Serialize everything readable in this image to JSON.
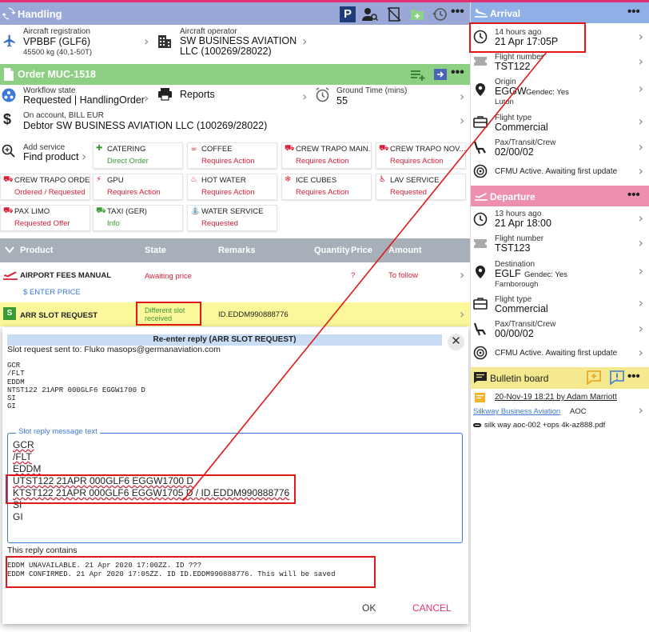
{
  "handling": {
    "title": "Handling",
    "aircraft_registration_label": "Aircraft registration",
    "aircraft_registration": "VPBBF (GLF6)",
    "aircraft_weight": "45500 kg (40,1-50T)",
    "aircraft_operator_label": "Aircraft operator",
    "aircraft_operator_line1": "SW BUSINESS AVIATION",
    "aircraft_operator_line2": "LLC (100269/28022)"
  },
  "order": {
    "title": "Order MUC-1518",
    "workflow_label": "Workflow state",
    "workflow_value": "Requested | HandlingOrder",
    "reports_label": "Reports",
    "ground_time_label": "Ground Time (mins)",
    "ground_time_value": "55",
    "account_label": "On account, BILL EUR",
    "account_value": "Debtor SW BUSINESS AVIATION LLC (100269/28022)",
    "add_service_label": "Add service",
    "find_product_label": "Find product"
  },
  "services": [
    {
      "name": "CATERING",
      "status": "Direct Order",
      "status_color": "#3a9a35",
      "icon": "catering-icon"
    },
    {
      "name": "COFFEE",
      "status": "Requires Action",
      "status_color": "#d6213a",
      "icon": "coffee-icon"
    },
    {
      "name": "CREW TRAPO MAIN...",
      "status": "Requires Action",
      "status_color": "#d6213a",
      "icon": "car-icon"
    },
    {
      "name": "CREW TRAPO NOV...",
      "status": "Requires Action",
      "status_color": "#d6213a",
      "icon": "car-icon"
    },
    {
      "name": "CREW TRAPO ORDER",
      "status": "Ordered / Requested",
      "status_color": "#d6213a",
      "icon": "car-icon"
    },
    {
      "name": "GPU",
      "status": "Requires Action",
      "status_color": "#d6213a",
      "icon": "plug-icon"
    },
    {
      "name": "HOT WATER",
      "status": "Requires Action",
      "status_color": "#d6213a",
      "icon": "hot-water-icon"
    },
    {
      "name": "ICE CUBES",
      "status": "Requires Action",
      "status_color": "#d6213a",
      "icon": "ice-icon"
    },
    {
      "name": "LAV SERVICE",
      "status": "Requested",
      "status_color": "#d6213a",
      "icon": "lav-icon"
    },
    {
      "name": "PAX LIMO",
      "status": "Requested Offer",
      "status_color": "#d6213a",
      "icon": "car-icon"
    },
    {
      "name": "TAXI (GER)",
      "status": "Info",
      "status_color": "#3a9a35",
      "icon": "taxi-icon"
    },
    {
      "name": "WATER SERVICE",
      "status": "Requested",
      "status_color": "#d6213a",
      "icon": "water-icon"
    }
  ],
  "product_table": {
    "headers": [
      "Product",
      "State",
      "Remarks",
      "Quantity",
      "Price",
      "Amount"
    ],
    "row1": {
      "product": "AIRPORT FEES MANUAL",
      "state": "Awaiting price",
      "price": "?",
      "amount": "To follow",
      "enter_price": "ENTER PRICE"
    },
    "row2": {
      "badge": "S",
      "product": "ARR SLOT REQUEST",
      "state_line1": "Different slot",
      "state_line2": "received",
      "remarks": "ID.EDDM990888776"
    }
  },
  "dialog": {
    "title": "Re-enter reply (ARR SLOT REQUEST)",
    "sent_to": "Slot request sent to: Fluko masops@germanaviation.com",
    "request_lines": [
      "GCR",
      "/FLT",
      "EDDM",
      "NTST122 21APR 000GLF6 EGGW1700 D",
      "SI",
      "GI"
    ],
    "reply_legend": "Slot reply message text",
    "reply_lines": [
      "GCR",
      "/FLT",
      "EDDM",
      "UTST122 21APR 000GLF6 EGGW1700 D",
      "KTST122 21APR 000GLF6 EGGW1705 D / ID.EDDM990888776",
      "SI",
      "GI"
    ],
    "contains_label": "This reply contains",
    "contains_lines": [
      "EDDM UNAVAILABLE. 21 Apr 2020 17:00ZZ. ID ???",
      "EDDM CONFIRMED. 21 Apr 2020 17:05ZZ. ID ID.EDDM990888776. This will be saved"
    ],
    "ok_label": "OK",
    "cancel_label": "CANCEL"
  },
  "arrival": {
    "title": "Arrival",
    "time_ago": "14 hours ago",
    "time": "21 Apr 17:05P",
    "flight_number_label": "Flight number",
    "flight_number": "TST122",
    "origin_label": "Origin",
    "origin": "EGGW",
    "origin_gendec": "Gendec: Yes",
    "origin_city": "Luton",
    "flight_type_label": "Flight type",
    "flight_type": "Commercial",
    "pax_label": "Pax/Transit/Crew",
    "pax": "02/00/02",
    "cfmu": "CFMU Active. Awaiting first update"
  },
  "departure": {
    "title": "Departure",
    "time_ago": "13 hours ago",
    "time": "21 Apr 18:00",
    "flight_number_label": "Flight number",
    "flight_number": "TST123",
    "destination_label": "Destination",
    "destination": "EGLF",
    "destination_gendec": "Gendec: Yes",
    "destination_city": "Farnborough",
    "flight_type_label": "Flight type",
    "flight_type": "Commercial",
    "pax_label": "Pax/Transit/Crew",
    "pax": "00/00/02",
    "cfmu": "CFMU Active. Awaiting first update"
  },
  "bulletin": {
    "title": "Bulletin board",
    "meta": "20-Nov-19 18:21 by Adam Marriott",
    "company": "Silkway Business Aviation",
    "tag": "AOC",
    "attachment": "silk way aoc-002 +ops 4k-az888.pdf"
  },
  "colors": {
    "handling_header": "#9aa8d8",
    "order_header": "#8dcf83",
    "arrival_header": "#8fb0e6",
    "departure_header": "#ee8fb0",
    "bulletin_header": "#f5e98f",
    "highlight_row": "#fbf79a",
    "annotation_red": "#e01818"
  }
}
